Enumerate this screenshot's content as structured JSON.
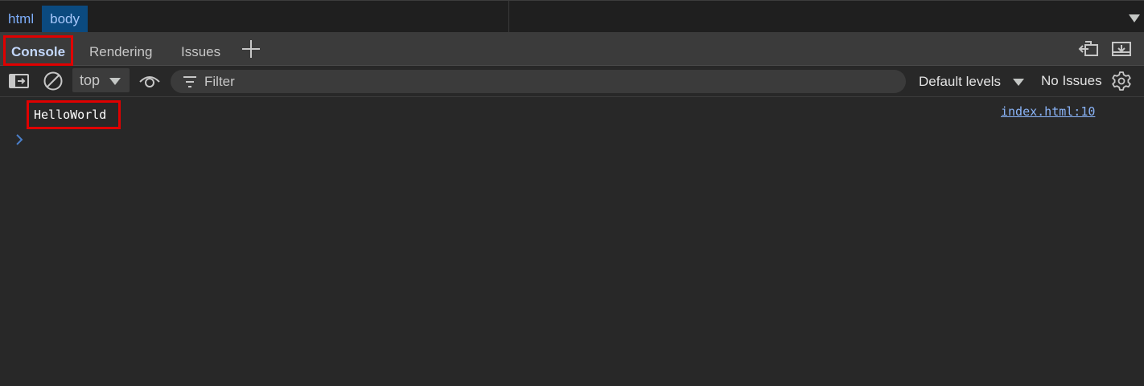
{
  "breadcrumbs": [
    "html",
    "body"
  ],
  "tabs": {
    "console": "Console",
    "rendering": "Rendering",
    "issues": "Issues"
  },
  "toolbar": {
    "context": "top",
    "filter_placeholder": "Filter",
    "levels": "Default levels",
    "issues": "No Issues"
  },
  "console": {
    "message": "HelloWorld",
    "source": "index.html:10"
  },
  "colors": {
    "highlight": "#e00000",
    "accent": "#8ab4f8",
    "selected_crumb": "#0b4a7f"
  },
  "icons": [
    "dock-side-icon",
    "undock-icon",
    "sidebar-toggle-icon",
    "clear-icon",
    "eye-icon",
    "filter-icon",
    "settings-icon",
    "prompt-chevron-icon"
  ]
}
